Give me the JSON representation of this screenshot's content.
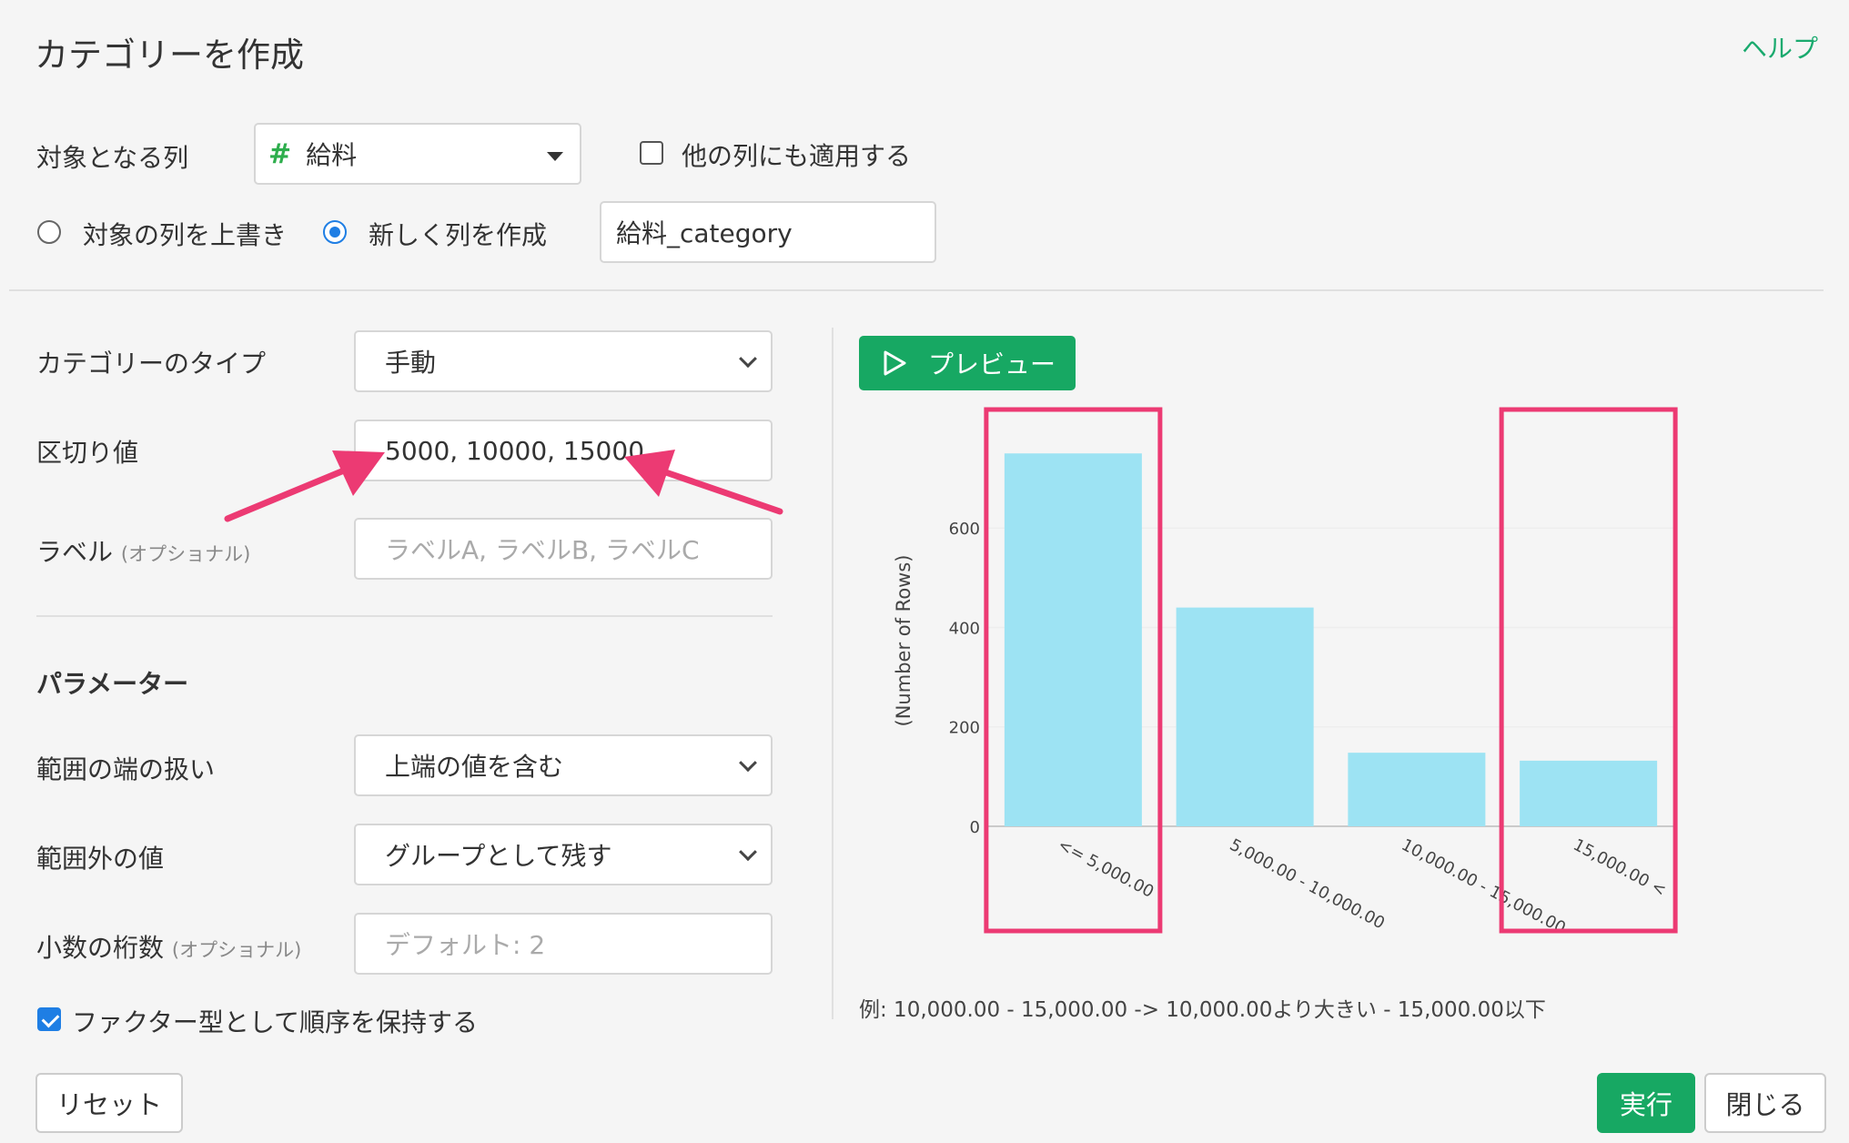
{
  "dialog": {
    "title": "カテゴリーを作成",
    "help": "ヘルプ"
  },
  "target": {
    "label": "対象となる列",
    "column": "給料",
    "column_type_icon": "number-hash-icon",
    "apply_other_label": "他の列にも適用する",
    "apply_other_checked": false,
    "overwrite_label": "対象の列を上書き",
    "new_column_label": "新しく列を作成",
    "mode_selected": "new",
    "new_column_name": "給料_category"
  },
  "settings": {
    "category_type_label": "カテゴリーのタイプ",
    "category_type_value": "手動",
    "breaks_label": "区切り値",
    "breaks_value": "5000, 10000, 15000",
    "labels_label": "ラベル",
    "labels_optional": "(オプショナル)",
    "labels_placeholder": "ラベルA, ラベルB, ラベルC"
  },
  "params": {
    "heading": "パラメーター",
    "edge_label": "範囲の端の扱い",
    "edge_value": "上端の値を含む",
    "outside_label": "範囲外の値",
    "outside_value": "グループとして残す",
    "digits_label": "小数の桁数",
    "digits_optional": "(オプショナル)",
    "digits_placeholder": "デフォルト: 2",
    "factor_label": "ファクター型として順序を保持する",
    "factor_checked": true
  },
  "preview": {
    "button_label": "プレビュー",
    "example": "例: 10,000.00 - 15,000.00 -> 10,000.00より大きい - 15,000.00以下"
  },
  "chart_data": {
    "type": "bar",
    "categories": [
      "<= 5,000.00",
      "5,000.00 - 10,000.00",
      "10,000.00 - 15,000.00",
      "15,000.00 <"
    ],
    "values": [
      750,
      440,
      148,
      132
    ],
    "ylabel": "(Number of Rows)",
    "yticks": [
      0,
      200,
      400,
      600
    ],
    "ylim": [
      0,
      820
    ],
    "bar_color": "#9de3f3",
    "grid": true,
    "highlight_color": "#ec3a73",
    "highlighted_categories": [
      "<= 5,000.00",
      "15,000.00 <"
    ]
  },
  "footer": {
    "reset": "リセット",
    "run": "実行",
    "close": "閉じる"
  },
  "colors": {
    "accent": "#17a863",
    "annotation": "#ec3a73",
    "radio_checked": "#1e7ee4"
  }
}
